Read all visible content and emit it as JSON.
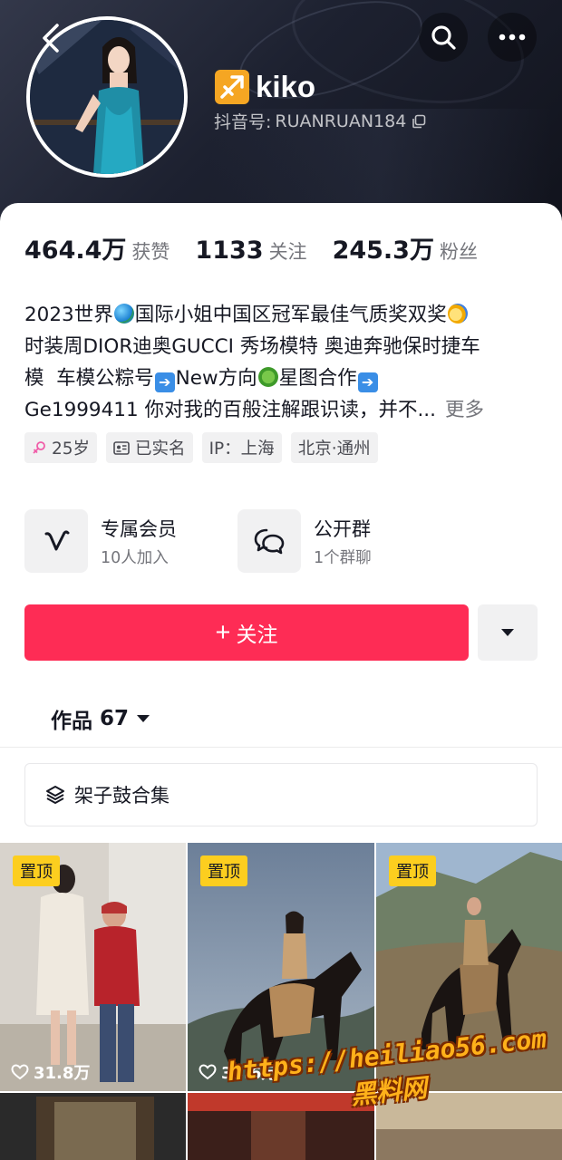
{
  "header": {
    "nickname": "kiko",
    "douyin_id_label": "抖音号:",
    "douyin_id": "RUANRUAN184",
    "icons": [
      "back-arrow-icon",
      "search-icon",
      "more-dots-icon",
      "copy-icon",
      "sagittarius-icon"
    ]
  },
  "stats": [
    {
      "value": "464.4万",
      "label": "获赞"
    },
    {
      "value": "1133",
      "label": "关注"
    },
    {
      "value": "245.3万",
      "label": "粉丝"
    }
  ],
  "bio": {
    "line1_a": "2023世界",
    "line1_b": "国际小姐中国区冠军最佳气质奖双奖",
    "line2": "时装周DIOR迪奥GUCCI 秀场模特 奥迪奔驰保时捷车",
    "line3_a": "模  车模公粽号",
    "line3_b": "New方向",
    "line3_c": "星图合作",
    "line4": "Ge1999411 你对我的百般注解跟识读，并不...",
    "more": "更多"
  },
  "tags": [
    {
      "icon": "female-icon",
      "label": "25岁"
    },
    {
      "icon": "id-card-icon",
      "label": "已实名"
    },
    {
      "icon": "",
      "label": "IP：上海"
    },
    {
      "icon": "",
      "label": "北京·通州"
    }
  ],
  "features": [
    {
      "icon": "vip-icon",
      "title": "专属会员",
      "subtitle": "10人加入"
    },
    {
      "icon": "group-chat-icon",
      "title": "公开群",
      "subtitle": "1个群聊"
    }
  ],
  "follow": {
    "label": "关注",
    "plus": "+",
    "color": "#fe2c55"
  },
  "works": {
    "label": "作品",
    "count": "67"
  },
  "collection": {
    "label": "架子鼓合集"
  },
  "videos": [
    {
      "pinned": "置顶",
      "likes": "31.8万"
    },
    {
      "pinned": "置顶",
      "likes": "33.6万"
    },
    {
      "pinned": "置顶",
      "likes": ""
    }
  ],
  "watermark": {
    "url": "https://heiliao56.com",
    "name": "黑料网"
  }
}
